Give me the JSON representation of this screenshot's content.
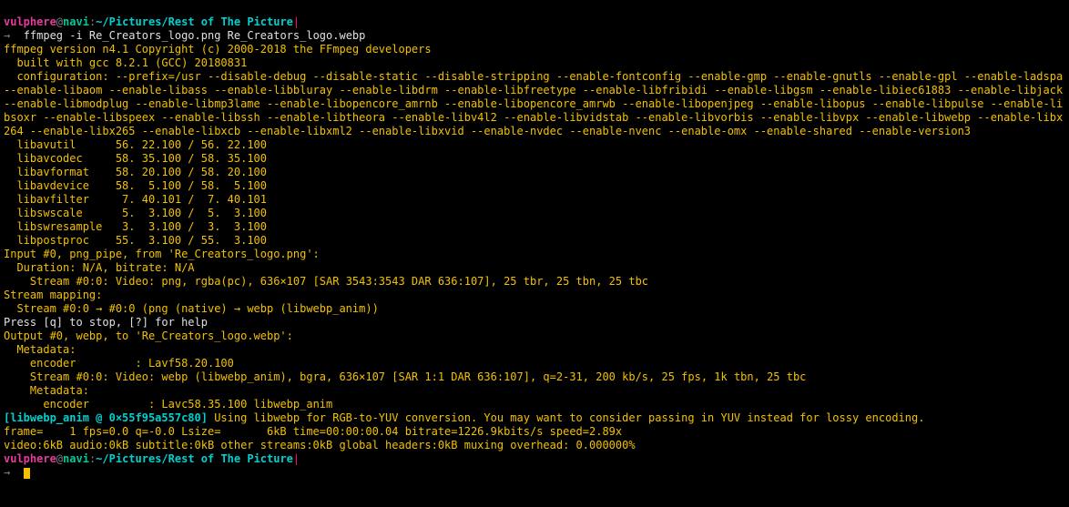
{
  "prompt": {
    "user": "vulphere",
    "at": "@",
    "host": "navi",
    "sep": ":",
    "path": "~/Pictures/Rest of The Picture",
    "mark": "|",
    "arrow": "→  "
  },
  "cmd": "ffmpeg -i Re_Creators_logo.png Re_Creators_logo.webp",
  "banner": "ffmpeg version n4.1 Copyright (c) 2000-2018 the FFmpeg developers",
  "built": "  built with gcc 8.2.1 (GCC) 20180831",
  "config": "  configuration: --prefix=/usr --disable-debug --disable-static --disable-stripping --enable-fontconfig --enable-gmp --enable-gnutls --enable-gpl --enable-ladspa --enable-libaom --enable-libass --enable-libbluray --enable-libdrm --enable-libfreetype --enable-libfribidi --enable-libgsm --enable-libiec61883 --enable-libjack --enable-libmodplug --enable-libmp3lame --enable-libopencore_amrnb --enable-libopencore_amrwb --enable-libopenjpeg --enable-libopus --enable-libpulse --enable-libsoxr --enable-libspeex --enable-libssh --enable-libtheora --enable-libv4l2 --enable-libvidstab --enable-libvorbis --enable-libvpx --enable-libwebp --enable-libx264 --enable-libx265 --enable-libxcb --enable-libxml2 --enable-libxvid --enable-nvdec --enable-nvenc --enable-omx --enable-shared --enable-version3",
  "libs": [
    "  libavutil      56. 22.100 / 56. 22.100",
    "  libavcodec     58. 35.100 / 58. 35.100",
    "  libavformat    58. 20.100 / 58. 20.100",
    "  libavdevice    58.  5.100 / 58.  5.100",
    "  libavfilter     7. 40.101 /  7. 40.101",
    "  libswscale      5.  3.100 /  5.  3.100",
    "  libswresample   3.  3.100 /  3.  3.100",
    "  libpostproc    55.  3.100 / 55.  3.100"
  ],
  "input_hdr": "Input #0, png_pipe, from 'Re_Creators_logo.png':",
  "duration": "  Duration: N/A, bitrate: N/A",
  "instream": "    Stream #0:0: Video: png, rgba(pc), 636×107 [SAR 3543:3543 DAR 636:107], 25 tbr, 25 tbn, 25 tbc",
  "map_hdr": "Stream mapping:",
  "map_line": "  Stream #0:0 → #0:0 (png (native) → webp (libwebp_anim))",
  "press": "Press [q] to stop, [?] for help",
  "out_hdr": "Output #0, webp, to 'Re_Creators_logo.webp':",
  "meta1": "  Metadata:",
  "enc1": "    encoder         : Lavf58.20.100",
  "outstream": "    Stream #0:0: Video: webp (libwebp_anim), bgra, 636×107 [SAR 1:1 DAR 636:107], q=2-31, 200 kb/s, 25 fps, 1k tbn, 25 tbc",
  "meta2": "    Metadata:",
  "enc2": "      encoder         : Lavc58.35.100 libwebp_anim",
  "warn_tag": "[libwebp_anim @ 0×55f95a557c80] ",
  "warn_msg": "Using libwebp for RGB-to-YUV conversion. You may want to consider passing in YUV instead for lossy encoding.",
  "frame": "frame=    1 fps=0.0 q=-0.0 Lsize=       6kB time=00:00:00.04 bitrate=1226.9kbits/s speed=2.89x    ",
  "summary": "video:6kB audio:0kB subtitle:0kB other streams:0kB global headers:0kB muxing overhead: 0.000000%"
}
